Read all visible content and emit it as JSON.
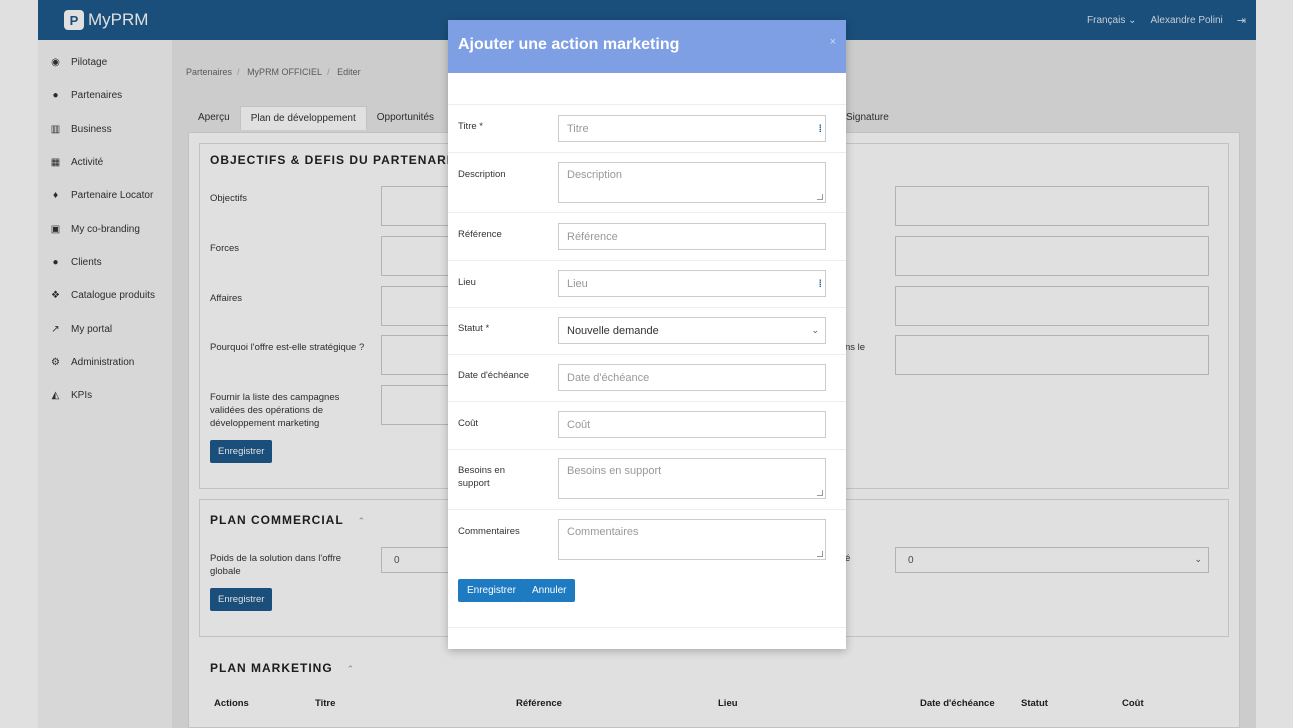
{
  "app": {
    "logo_letter": "P",
    "name": "MyPRM"
  },
  "header": {
    "language": "Français ⌄",
    "user": "Alexandre Polini"
  },
  "sidebar": {
    "items": [
      {
        "label": "Pilotage",
        "icon": "dashboard-icon"
      },
      {
        "label": "Partenaires",
        "icon": "users-icon"
      },
      {
        "label": "Business",
        "icon": "bar-chart-icon"
      },
      {
        "label": "Activité",
        "icon": "calendar-icon"
      },
      {
        "label": "Partenaire Locator",
        "icon": "map-pin-icon"
      },
      {
        "label": "My co-branding",
        "icon": "image-icon"
      },
      {
        "label": "Clients",
        "icon": "users-icon"
      },
      {
        "label": "Catalogue produits",
        "icon": "cubes-icon"
      },
      {
        "label": "My portal",
        "icon": "external-link-icon"
      },
      {
        "label": "Administration",
        "icon": "cogs-icon"
      },
      {
        "label": "KPIs",
        "icon": "area-chart-icon"
      }
    ]
  },
  "breadcrumb": [
    "Partenaires",
    "MyPRM OFFICIEL",
    "Editer"
  ],
  "tabs": [
    "Aperçu",
    "Plan de développement",
    "Opportunités"
  ],
  "tab_right": "Signature",
  "objectifs": {
    "title": "OBJECTIFS & DEFIS DU PARTENARIA",
    "labels": [
      "Objectifs",
      "Forces",
      "Affaires",
      "Pourquoi l'offre est-elle stratégique ?",
      "Fournir la liste des campagnes validées des opérations de développement marketing"
    ],
    "right_label_fragment": "ns le",
    "save": "Enregistrer"
  },
  "plan_commercial": {
    "title": "PLAN COMMERCIAL",
    "poids_label": "Poids de la solution dans l'offre globale",
    "poids_value": "0",
    "right_fragment": "é",
    "right_value": "0",
    "save": "Enregistrer"
  },
  "plan_marketing": {
    "title": "PLAN MARKETING",
    "columns": [
      "Actions",
      "Titre",
      "Référence",
      "Lieu",
      "Date d'échéance",
      "Statut",
      "Coût"
    ]
  },
  "modal": {
    "title": "Ajouter une action marketing",
    "close": "×",
    "fields": {
      "titre": {
        "label": "Titre *",
        "placeholder": "Titre"
      },
      "description": {
        "label": "Description",
        "placeholder": "Description"
      },
      "reference": {
        "label": "Référence",
        "placeholder": "Référence"
      },
      "lieu": {
        "label": "Lieu",
        "placeholder": "Lieu"
      },
      "statut": {
        "label": "Statut *",
        "value": "Nouvelle demande"
      },
      "date": {
        "label": "Date d'échéance",
        "placeholder": "Date d'échéance"
      },
      "cout": {
        "label": "Coût",
        "placeholder": "Coût"
      },
      "besoins": {
        "label": "Besoins en support",
        "placeholder": "Besoins en support"
      },
      "commentaires": {
        "label": "Commentaires",
        "placeholder": "Commentaires"
      }
    },
    "save": "Enregistrer",
    "cancel": "Annuler"
  }
}
